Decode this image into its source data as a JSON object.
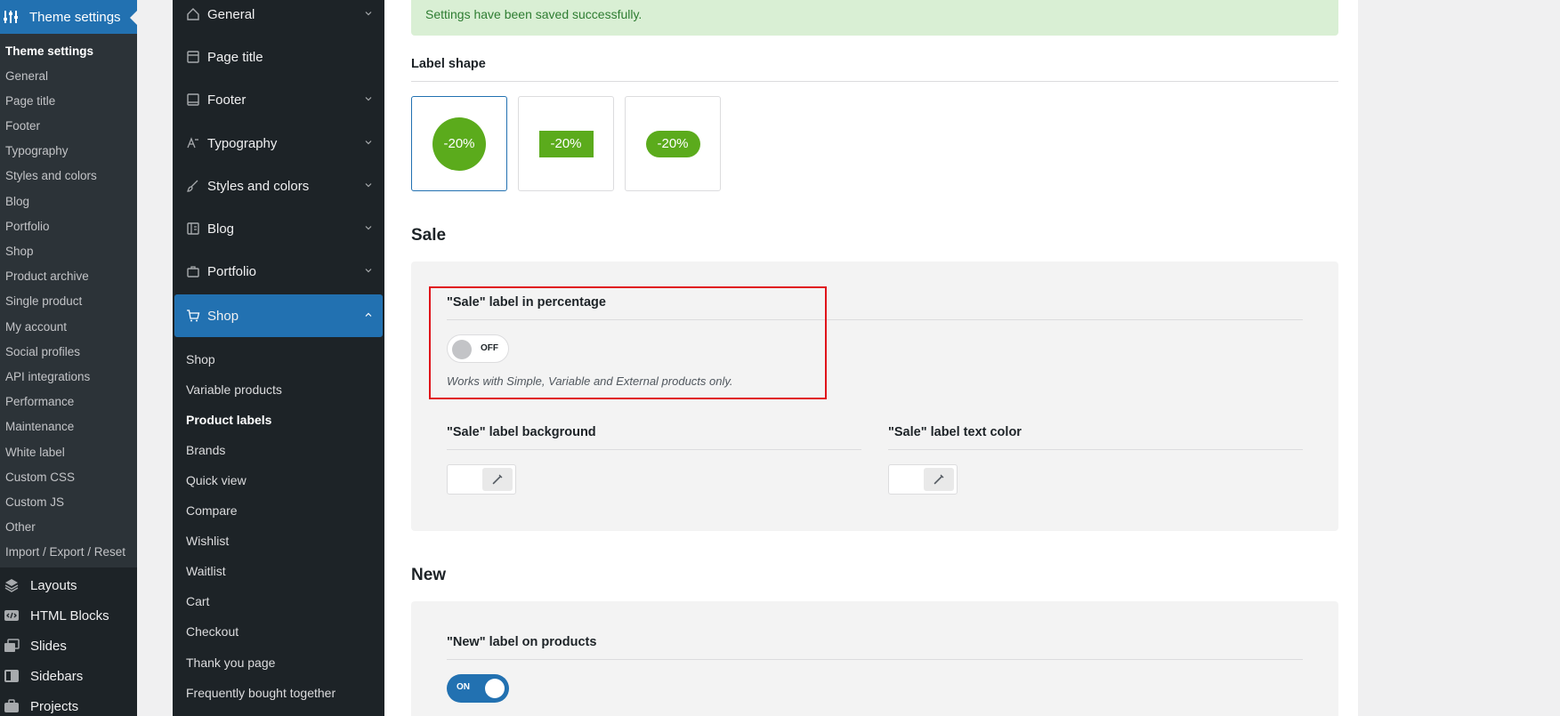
{
  "wp_sidebar": {
    "active_menu": "Theme settings",
    "submenu": [
      {
        "label": "Theme settings",
        "current": true
      },
      {
        "label": "General"
      },
      {
        "label": "Page title"
      },
      {
        "label": "Footer"
      },
      {
        "label": "Typography"
      },
      {
        "label": "Styles and colors"
      },
      {
        "label": "Blog"
      },
      {
        "label": "Portfolio"
      },
      {
        "label": "Shop"
      },
      {
        "label": "Product archive"
      },
      {
        "label": "Single product"
      },
      {
        "label": "My account"
      },
      {
        "label": "Social profiles"
      },
      {
        "label": "API integrations"
      },
      {
        "label": "Performance"
      },
      {
        "label": "Maintenance"
      },
      {
        "label": "White label"
      },
      {
        "label": "Custom CSS"
      },
      {
        "label": "Custom JS"
      },
      {
        "label": "Other"
      },
      {
        "label": "Import / Export / Reset"
      }
    ],
    "menu": [
      {
        "label": "Layouts",
        "icon": "layers-icon"
      },
      {
        "label": "HTML Blocks",
        "icon": "html-block-icon"
      },
      {
        "label": "Slides",
        "icon": "slides-icon"
      },
      {
        "label": "Sidebars",
        "icon": "sidebar-icon"
      },
      {
        "label": "Projects",
        "icon": "briefcase-icon"
      }
    ]
  },
  "theme_nav": {
    "items": [
      {
        "label": "General",
        "icon": "home-icon"
      },
      {
        "label": "Page title",
        "icon": "page-title-icon"
      },
      {
        "label": "Footer",
        "icon": "footer-icon"
      },
      {
        "label": "Typography",
        "icon": "typography-icon"
      },
      {
        "label": "Styles and colors",
        "icon": "brush-icon"
      },
      {
        "label": "Blog",
        "icon": "blog-icon"
      },
      {
        "label": "Portfolio",
        "icon": "briefcase-icon"
      },
      {
        "label": "Shop",
        "icon": "cart-icon",
        "active": true
      }
    ],
    "shop_subitems": [
      {
        "label": "Shop"
      },
      {
        "label": "Variable products"
      },
      {
        "label": "Product labels",
        "current": true
      },
      {
        "label": "Brands"
      },
      {
        "label": "Quick view"
      },
      {
        "label": "Compare"
      },
      {
        "label": "Wishlist"
      },
      {
        "label": "Waitlist"
      },
      {
        "label": "Cart"
      },
      {
        "label": "Checkout"
      },
      {
        "label": "Thank you page"
      },
      {
        "label": "Frequently bought together"
      }
    ]
  },
  "main": {
    "notice": "Settings have been saved successfully.",
    "label_shape": {
      "title": "Label shape",
      "options": [
        {
          "text": "-20%",
          "shape": "circle",
          "selected": true
        },
        {
          "text": "-20%",
          "shape": "rectangle"
        },
        {
          "text": "-20%",
          "shape": "rounded"
        }
      ]
    },
    "sale": {
      "heading": "Sale",
      "percentage_label": "\"Sale\" label in percentage",
      "toggle_state": "OFF",
      "hint": "Works with Simple, Variable and External products only.",
      "bg_label": "\"Sale\" label background",
      "text_color_label": "\"Sale\" label text color"
    },
    "new": {
      "heading": "New",
      "label": "\"New\" label on products",
      "toggle_state": "ON"
    }
  },
  "colors": {
    "accent": "#2271b1",
    "label_green": "#5bab1c",
    "notice_bg": "#d9efd4",
    "highlight": "#e0131a"
  }
}
